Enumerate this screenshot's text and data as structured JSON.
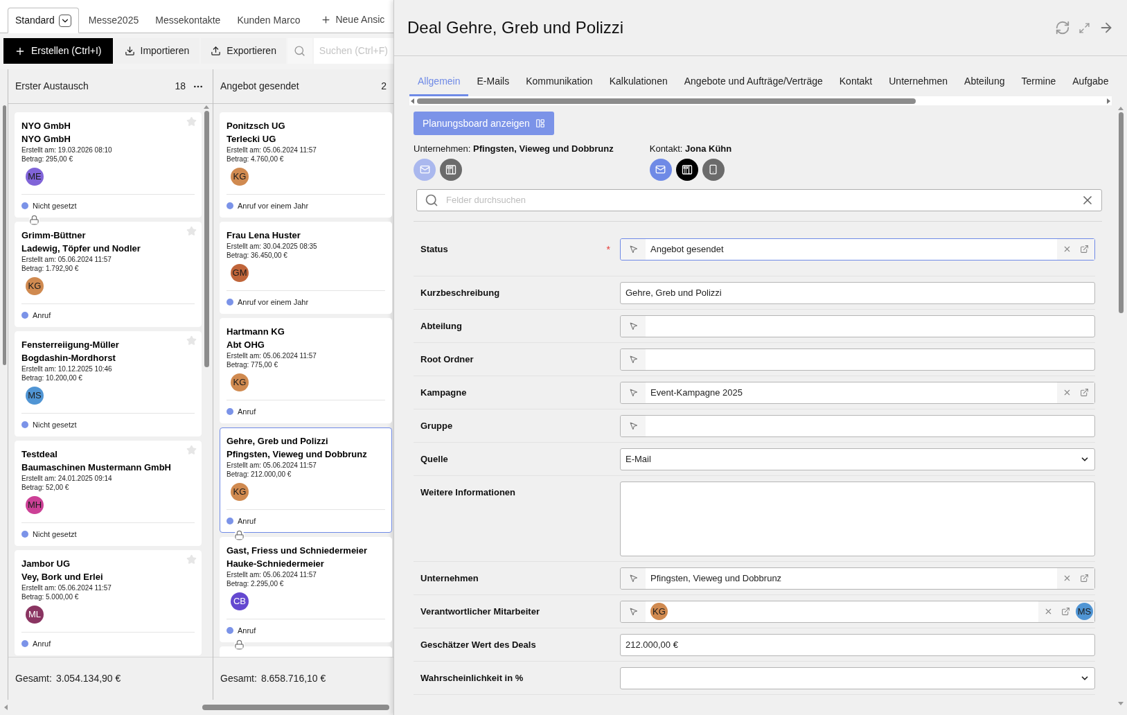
{
  "view_tabs": [
    {
      "label": "Standard",
      "selected": true,
      "dropdown": true
    },
    {
      "label": "Messe2025",
      "selected": false,
      "dropdown": false
    },
    {
      "label": "Messekontakte",
      "selected": false,
      "dropdown": false
    },
    {
      "label": "Kunden Marco",
      "selected": false,
      "dropdown": false
    }
  ],
  "new_view": "Neue Ansic",
  "toolbar": {
    "create": "Erstellen (Ctrl+I)",
    "import": "Importieren",
    "export": "Exportieren",
    "search_placeholder": "Suchen (Ctrl+F)"
  },
  "columns": [
    {
      "title": "Erster Austausch",
      "count": "18",
      "has_menu": true,
      "card_stars": true,
      "total_label": "Gesamt:",
      "total": "3.054.134,90 €",
      "cards": [
        {
          "title": "NYO GmbH",
          "subtitle": "NYO GmbH",
          "created": "Erstellt am: 19.03.2026 08:10",
          "amount": "Betrag: 295,00 €",
          "avatar": {
            "initials": "ME",
            "color": "#8064d8"
          },
          "activity": "Nicht gesetzt",
          "locked": false,
          "selected": false
        },
        {
          "title": "Grimm-Büttner",
          "subtitle": "Ladewig, Töpfer und Nodler",
          "created": "Erstellt am: 05.06.2024 11:57",
          "amount": "Betrag: 1.792,90 €",
          "avatar": {
            "initials": "KG",
            "color": "#d08a50"
          },
          "activity": "Anruf",
          "locked": true,
          "selected": false
        },
        {
          "title": "Fensterreiigung-Müller",
          "subtitle": "Bogdashin-Mordhorst",
          "created": "Erstellt am: 10.12.2025 10:46",
          "amount": "Betrag: 10.200,00 €",
          "avatar": {
            "initials": "MS",
            "color": "#5095d4"
          },
          "activity": "Nicht gesetzt",
          "locked": false,
          "selected": false
        },
        {
          "title": "Testdeal",
          "subtitle": "Baumaschinen Mustermann GmbH",
          "created": "Erstellt am: 24.01.2025 09:14",
          "amount": "Betrag: 52,00 €",
          "avatar": {
            "initials": "MH",
            "color": "#cc4096"
          },
          "activity": "Nicht gesetzt",
          "locked": false,
          "selected": false
        },
        {
          "title": "Jambor UG",
          "subtitle": "Vey, Bork und Erlei",
          "created": "Erstellt am: 05.06.2024 11:57",
          "amount": "Betrag: 5.000,00 €",
          "avatar": {
            "initials": "ML",
            "color": "#8a3461"
          },
          "activity": "Anruf",
          "locked": false,
          "selected": false
        }
      ]
    },
    {
      "title": "Angebot gesendet",
      "count": "2",
      "has_menu": false,
      "card_stars": false,
      "total_label": "Gesamt:",
      "total": "8.658.716,10 €",
      "cards": [
        {
          "title": "Ponitzsch UG",
          "subtitle": "Terlecki UG",
          "created": "Erstellt am: 05.06.2024 11:57",
          "amount": "Betrag: 4.760,00 €",
          "avatar": {
            "initials": "KG",
            "color": "#d08a50"
          },
          "activity": "Anruf vor einem Jahr",
          "locked": false,
          "selected": false
        },
        {
          "title": "Frau Lena Huster",
          "created": "Erstellt am: 30.04.2025 08:35",
          "amount": "Betrag: 36.450,00 €",
          "avatar": {
            "initials": "GM",
            "color": "#c0653a"
          },
          "activity": "Anruf vor einem Jahr",
          "locked": false,
          "selected": false
        },
        {
          "title": "Hartmann KG",
          "subtitle": "Abt OHG",
          "created": "Erstellt am: 05.06.2024 11:57",
          "amount": "Betrag: 775,00 €",
          "avatar": {
            "initials": "KG",
            "color": "#d08a50"
          },
          "activity": "Anruf",
          "locked": false,
          "selected": false
        },
        {
          "title": "Gehre, Greb und Polizzi",
          "subtitle": "Pfingsten, Vieweg und Dobbrunz",
          "created": "Erstellt am: 05.06.2024 11:57",
          "amount": "Betrag: 212.000,00 €",
          "avatar": {
            "initials": "KG",
            "color": "#d08a50"
          },
          "activity": "Anruf",
          "locked": false,
          "selected": true
        },
        {
          "title": "Gast, Friess und Schniedermeier",
          "subtitle": "Hauke-Schniedermeier",
          "created": "Erstellt am: 05.06.2024 11:57",
          "amount": "Betrag: 2.295,00 €",
          "avatar": {
            "initials": "CB",
            "color": "#6448d0"
          },
          "activity": "Anruf",
          "locked": true,
          "selected": false
        },
        {
          "locked": true,
          "selected": false
        }
      ]
    }
  ],
  "detail": {
    "title": "Deal Gehre, Greb und Polizzi",
    "tabs": [
      {
        "label": "Allgemein",
        "selected": true
      },
      {
        "label": "E-Mails",
        "selected": false
      },
      {
        "label": "Kommunikation",
        "selected": false
      },
      {
        "label": "Kalkulationen",
        "selected": false
      },
      {
        "label": "Angebote und Aufträge/Verträge",
        "selected": false
      },
      {
        "label": "Kontakt",
        "selected": false
      },
      {
        "label": "Unternehmen",
        "selected": false
      },
      {
        "label": "Abteilung",
        "selected": false
      },
      {
        "label": "Termine",
        "selected": false
      },
      {
        "label": "Aufgabe",
        "selected": false
      }
    ],
    "board_button": "Planungsboard anzeigen",
    "company": {
      "label": "Unternehmen:",
      "name": "Pfingsten, Vieweg und Dobbrunz",
      "actions": [
        {
          "kind": "email",
          "disabled": true,
          "active": false
        },
        {
          "kind": "phone",
          "disabled": false,
          "active": false
        }
      ]
    },
    "contact": {
      "label": "Kontakt:",
      "name": "Jona Kühn",
      "actions": [
        {
          "kind": "email",
          "disabled": false,
          "active": false
        },
        {
          "kind": "phone",
          "disabled": false,
          "active": true
        },
        {
          "kind": "mobile",
          "disabled": false,
          "active": false
        }
      ]
    },
    "field_search_placeholder": "Felder durchsuchen",
    "fields": [
      {
        "label": "Status",
        "kind": "lookup",
        "required_mark": "*",
        "focused": true,
        "value": "Angebot gesendet"
      },
      {
        "label": "Kurzbeschreibung",
        "kind": "text",
        "focused": false,
        "value": "Gehre, Greb und Polizzi"
      },
      {
        "label": "Abteilung",
        "kind": "lookup",
        "focused": false
      },
      {
        "label": "Root Ordner",
        "kind": "lookup",
        "focused": false
      },
      {
        "label": "Kampagne",
        "kind": "lookup",
        "focused": false,
        "value": "Event-Kampagne 2025"
      },
      {
        "label": "Gruppe",
        "kind": "lookup",
        "focused": false
      },
      {
        "label": "Quelle",
        "kind": "select",
        "focused": false,
        "value": "E-Mail"
      },
      {
        "label": "Weitere Informationen",
        "kind": "textarea",
        "focused": false
      },
      {
        "label": "Unternehmen",
        "kind": "lookup",
        "focused": false,
        "value": "Pfingsten, Vieweg und Dobbrunz"
      },
      {
        "label": "Verantwortlicher Mitarbeiter",
        "kind": "people",
        "focused": false,
        "avatars": [
          {
            "initials": "KG",
            "color": "#d08a50"
          }
        ],
        "trailing_avatar": {
          "initials": "MS",
          "color": "#5095d4"
        }
      },
      {
        "label": "Geschätzer Wert des Deals",
        "kind": "text",
        "focused": false,
        "value": "212.000,00 €"
      },
      {
        "label": "Wahrscheinlichkeit in %",
        "kind": "select",
        "focused": false
      }
    ]
  }
}
